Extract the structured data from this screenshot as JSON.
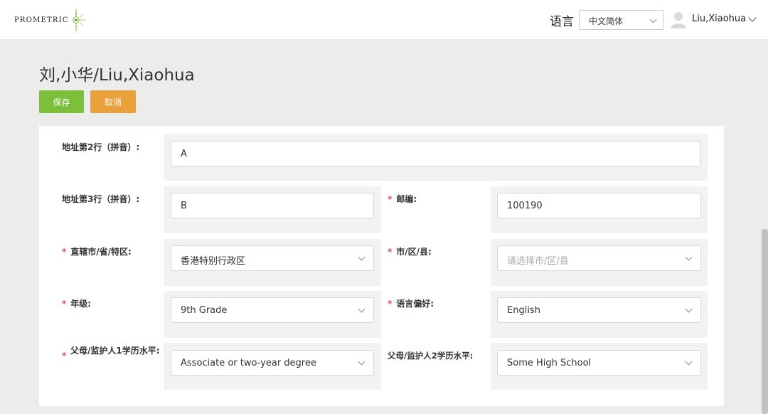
{
  "header": {
    "logo_text": "PROMETRIC",
    "language_label": "语言",
    "language_value": "中文简体",
    "user_name": "Liu,Xiaohua"
  },
  "page": {
    "title": "刘,小华/Liu,Xiaohua",
    "save_label": "保存",
    "cancel_label": "取消"
  },
  "form": {
    "address2": {
      "label": "地址第2行（拼音）:",
      "value": "A"
    },
    "address3": {
      "label": "地址第3行（拼音）:",
      "value": "B"
    },
    "postcode": {
      "label": "邮编:",
      "value": "100190"
    },
    "province": {
      "label": "直辖市/省/特区:",
      "value": "香港特别行政区"
    },
    "city": {
      "label": "市/区/县:",
      "placeholder": "请选择市/区/县"
    },
    "grade": {
      "label": "年级:",
      "value": "9th Grade"
    },
    "language_pref": {
      "label": "语言偏好:",
      "value": "English"
    },
    "parent1_edu": {
      "label": "父母/监护人1学历水平:",
      "value": "Associate or two-year degree"
    },
    "parent2_edu": {
      "label": "父母/监护人2学历水平:",
      "value": "Some High School"
    },
    "required_mark": "*"
  },
  "colors": {
    "save_button": "#7cbf3a",
    "cancel_button": "#eaa13c",
    "required": "#e64a4a",
    "logo_star": "#7cbf3a"
  },
  "icons": {
    "logo": "prometric-star-icon",
    "avatar": "user-avatar-icon",
    "dropdown": "chevron-down-icon"
  }
}
